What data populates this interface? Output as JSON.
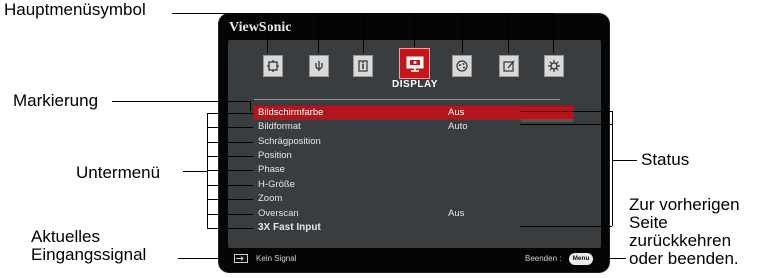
{
  "callouts": {
    "hauptmenu": "Hauptmenüsymbol",
    "markierung": "Markierung",
    "untermenu": "Untermenü",
    "aktuelles_1": "Aktuelles",
    "aktuelles_2": "Eingangssignal",
    "status": "Status",
    "zur_1": "Zur vorherigen",
    "zur_2": "Seite",
    "zur_3": "zurückkehren",
    "zur_4": "oder beenden."
  },
  "osd": {
    "brand": "ViewSonic",
    "menu_title": "DISPLAY",
    "icons": [
      "picture-settings-icon",
      "power-settings-icon",
      "info-icon",
      "display-icon",
      "color-icon",
      "advanced-icon",
      "system-icon"
    ],
    "rows": [
      {
        "label": "Bildschirmfarbe",
        "value": "Aus"
      },
      {
        "label": "Bildformat",
        "value": "Auto"
      },
      {
        "label": "Schrägposition",
        "value": ""
      },
      {
        "label": "Position",
        "value": ""
      },
      {
        "label": "Phase",
        "value": ""
      },
      {
        "label": "H-Größe",
        "value": ""
      },
      {
        "label": "Zoom",
        "value": ""
      },
      {
        "label": "Overscan",
        "value": "Aus"
      },
      {
        "label": "3X Fast Input",
        "value": ""
      }
    ],
    "signal_text": "Kein Signal",
    "exit_text": "Beenden :",
    "menu_key": "Menu"
  },
  "colors": {
    "highlight": "#b4141b",
    "panel": "#3a3d3f",
    "frame": "#050505"
  }
}
